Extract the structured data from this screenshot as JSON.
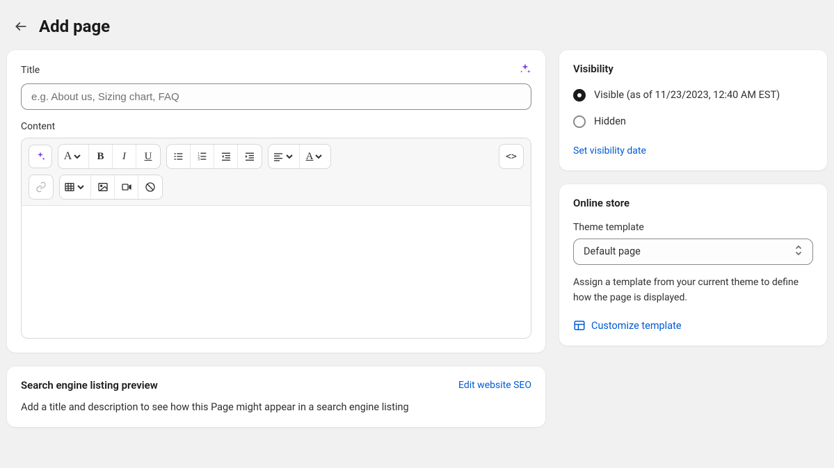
{
  "header": {
    "title": "Add page"
  },
  "main": {
    "title_label": "Title",
    "title_placeholder": "e.g. About us, Sizing chart, FAQ",
    "title_value": "",
    "content_label": "Content"
  },
  "seo": {
    "title": "Search engine listing preview",
    "edit_link": "Edit website SEO",
    "description": "Add a title and description to see how this Page might appear in a search engine listing"
  },
  "visibility": {
    "title": "Visibility",
    "options": [
      {
        "label": "Visible (as of 11/23/2023, 12:40 AM EST)",
        "selected": true
      },
      {
        "label": "Hidden",
        "selected": false
      }
    ],
    "set_date_link": "Set visibility date"
  },
  "online_store": {
    "title": "Online store",
    "template_label": "Theme template",
    "template_value": "Default page",
    "description": "Assign a template from your current theme to define how the page is displayed.",
    "customize_link": "Customize template"
  }
}
